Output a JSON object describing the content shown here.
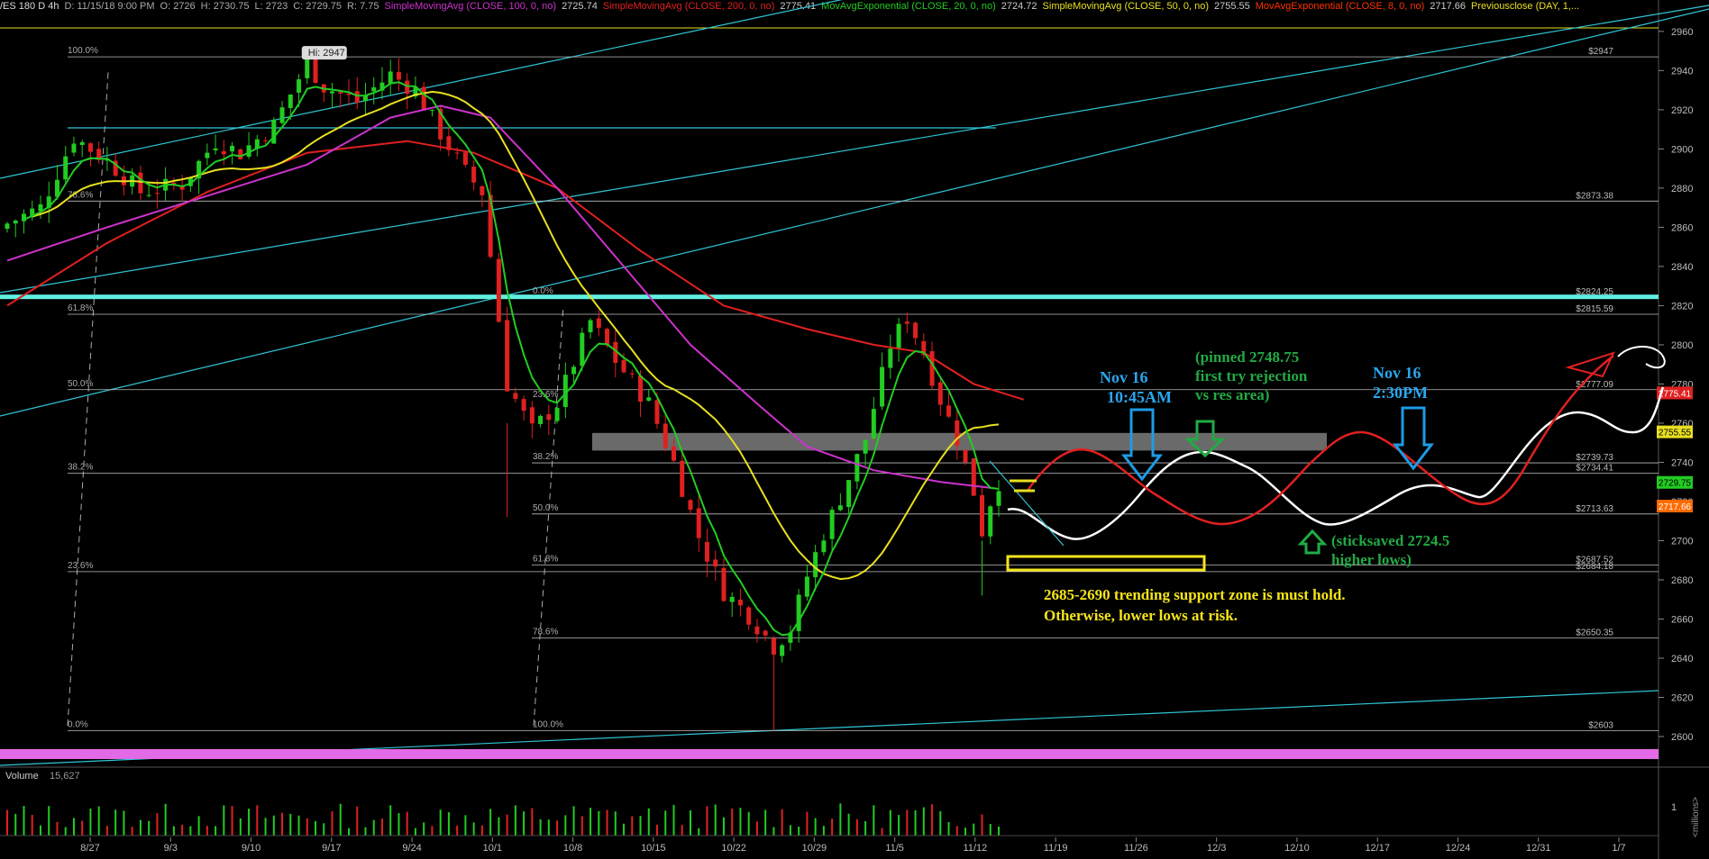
{
  "header": {
    "symbol": "/ES 180 D 4h",
    "date": "D: 11/15/18 9:00 PM",
    "open": "O: 2726",
    "high": "H: 2730.75",
    "low": "L: 2723",
    "close": "C: 2729.75",
    "range": "R: 7.75",
    "studies": [
      {
        "label": "SimpleMovingAvg (CLOSE, 100, 0, no)",
        "value": "2725.74",
        "color": "#cc33cc"
      },
      {
        "label": "SimpleMovingAvg (CLOSE, 200, 0, no)",
        "value": "2775.41",
        "color": "#e02020"
      },
      {
        "label": "MovAvgExponential (CLOSE, 20, 0, no)",
        "value": "2724.72",
        "color": "#22cc22"
      },
      {
        "label": "SimpleMovingAvg (CLOSE, 50, 0, no)",
        "value": "2755.55",
        "color": "#e8e020"
      },
      {
        "label": "MovAvgExponential (CLOSE, 8, 0, no)",
        "value": "2717.66",
        "color": "#ff3300"
      },
      {
        "label": "Previousclose (DAY, 1,...",
        "value": "",
        "color": "#e8e020"
      }
    ]
  },
  "chart_data": {
    "type": "candlestick",
    "ylim": [
      2600,
      2965
    ],
    "y_ticks": [
      "2960",
      "2940",
      "2920",
      "2900",
      "2880",
      "2860",
      "2840",
      "2820",
      "2800",
      "2780",
      "2760",
      "2740",
      "2720",
      "2700",
      "2680",
      "2660",
      "2640",
      "2620",
      "2600"
    ],
    "x_ticks": [
      "8/27",
      "9/3",
      "9/10",
      "9/17",
      "9/24",
      "10/1",
      "10/8",
      "10/15",
      "10/22",
      "10/29",
      "11/5",
      "11/12",
      "11/19",
      "11/26",
      "12/3",
      "12/10",
      "12/17",
      "12/24",
      "12/31",
      "1/7"
    ],
    "bubble": "Hi: 2947",
    "price_labels": [
      {
        "text": "2775.41",
        "value": 2775.41,
        "color": "#e02020"
      },
      {
        "text": "2755.55",
        "value": 2755.55,
        "color": "#e8e020"
      },
      {
        "text": "2729.75",
        "value": 2729.75,
        "color": "#22cc22"
      },
      {
        "text": "2717.66",
        "value": 2717.66,
        "color": "#ff6a00"
      }
    ],
    "level_labels": [
      {
        "text": "$2947",
        "value": 2947
      },
      {
        "text": "$2873.38",
        "value": 2873.38
      },
      {
        "text": "$2824.25",
        "value": 2824.25
      },
      {
        "text": "$2815.59",
        "value": 2815.59
      },
      {
        "text": "$2777.09",
        "value": 2777.09
      },
      {
        "text": "$2739.73",
        "value": 2739.73
      },
      {
        "text": "$2734.41",
        "value": 2734.41
      },
      {
        "text": "$2713.63",
        "value": 2713.63
      },
      {
        "text": "$2687.52",
        "value": 2687.52
      },
      {
        "text": "$2684.18",
        "value": 2684.18
      },
      {
        "text": "$2650.35",
        "value": 2650.35
      },
      {
        "text": "$2603",
        "value": 2603
      }
    ],
    "fib_left": [
      {
        "text": "100.0%",
        "value": 2947
      },
      {
        "text": "78.6%",
        "value": 2873.38
      },
      {
        "text": "61.8%",
        "value": 2815.59
      },
      {
        "text": "50.0%",
        "value": 2777.09
      },
      {
        "text": "38.2%",
        "value": 2734.41
      },
      {
        "text": "23.6%",
        "value": 2684.18
      },
      {
        "text": "0.0%",
        "value": 2603
      }
    ],
    "fib_mid": [
      {
        "text": "0.0%",
        "value": 2824.25
      },
      {
        "text": "23.6%",
        "value": 2771.5
      },
      {
        "text": "38.2%",
        "value": 2739.73
      },
      {
        "text": "50.0%",
        "value": 2713.63
      },
      {
        "text": "61.8%",
        "value": 2687.52
      },
      {
        "text": "78.6%",
        "value": 2650.35
      },
      {
        "text": "100.0%",
        "value": 2603
      }
    ],
    "anchors": [
      [
        0,
        2862
      ],
      [
        4,
        2870
      ],
      [
        8,
        2906
      ],
      [
        12,
        2894
      ],
      [
        16,
        2878
      ],
      [
        21,
        2882
      ],
      [
        25,
        2904
      ],
      [
        28,
        2898
      ],
      [
        32,
        2912
      ],
      [
        36,
        2944
      ],
      [
        38,
        2932
      ],
      [
        42,
        2924
      ],
      [
        46,
        2938
      ],
      [
        49,
        2930
      ],
      [
        52,
        2908
      ],
      [
        55,
        2888
      ],
      [
        57,
        2878
      ],
      [
        60,
        2780
      ],
      [
        63,
        2756
      ],
      [
        66,
        2770
      ],
      [
        70,
        2812
      ],
      [
        73,
        2792
      ],
      [
        77,
        2770
      ],
      [
        80,
        2740
      ],
      [
        83,
        2702
      ],
      [
        86,
        2674
      ],
      [
        89,
        2662
      ],
      [
        92,
        2646
      ],
      [
        94,
        2655
      ],
      [
        96,
        2682
      ],
      [
        98,
        2704
      ],
      [
        100,
        2722
      ],
      [
        103,
        2752
      ],
      [
        106,
        2800
      ],
      [
        108,
        2814
      ],
      [
        110,
        2796
      ],
      [
        112,
        2772
      ],
      [
        114,
        2752
      ],
      [
        116,
        2725
      ],
      [
        117,
        2705
      ],
      [
        118,
        2720
      ],
      [
        119,
        2730
      ]
    ],
    "volume": {
      "label": "Volume",
      "value": "15,627",
      "ylim": [
        0,
        2
      ],
      "ticks": [
        "1"
      ],
      "unit": "<millions>"
    },
    "annotations": {
      "nov16_am": [
        "Nov 16",
        "10:45AM"
      ],
      "pinned": [
        "(pinned 2748.75",
        "first try rejection",
        "vs res area)"
      ],
      "nov16_pm": [
        "Nov 16",
        "2:30PM"
      ],
      "sticksaved": [
        "(sticksaved 2724.5",
        "higher lows)"
      ],
      "support": [
        "2685-2690 trending support zone is must hold.",
        "Otherwise, lower lows at risk."
      ]
    }
  }
}
